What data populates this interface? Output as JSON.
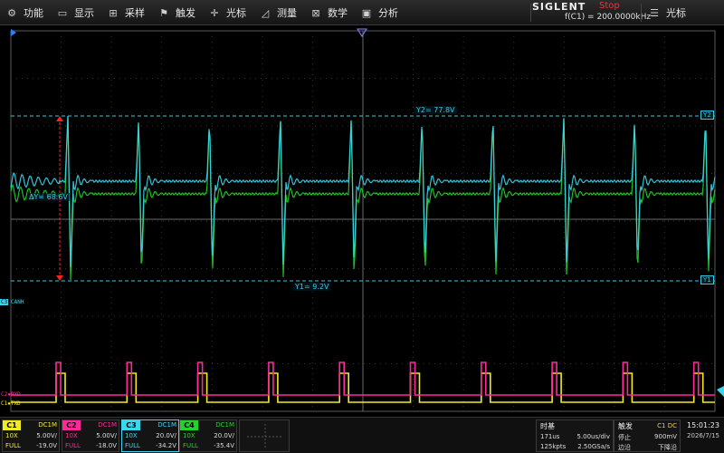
{
  "menu": {
    "items": [
      {
        "label": "功能",
        "icon": "gear-icon"
      },
      {
        "label": "显示",
        "icon": "display-icon"
      },
      {
        "label": "采样",
        "icon": "acquire-icon"
      },
      {
        "label": "触发",
        "icon": "trigger-flag-icon"
      },
      {
        "label": "光标",
        "icon": "cursor-icon"
      },
      {
        "label": "测量",
        "icon": "measure-icon"
      },
      {
        "label": "数学",
        "icon": "math-icon"
      },
      {
        "label": "分析",
        "icon": "analysis-icon"
      }
    ],
    "brand": "SIGLENT",
    "run_status": "Stop",
    "frequency": "f(C1) = 200.0000kHz",
    "cursor_menu": "光标"
  },
  "screen": {
    "cursor_y2_readout": "Y2= 77.8V",
    "cursor_y1_readout": "Y1= 9.2V",
    "delta_y_readout": "ΔY= 68.6V",
    "y2_tag": "Y2",
    "y1_tag": "Y1",
    "c3_tag": "C3",
    "c3_label": "CANH",
    "c2_label": "C2▪RXD",
    "c1_label": "C1▪TXD",
    "colors": {
      "c1": "#f2ea25",
      "c2": "#ff2a9a",
      "c3": "#3ad6ee",
      "c4": "#22d32a",
      "cursor": "#38c8e6"
    }
  },
  "channels": [
    {
      "name": "C1",
      "coupling": "DC1M",
      "probe": "10X",
      "scale": "5.00V/",
      "bw": "FULL",
      "offset": "-19.0V",
      "color": "#f2ea25"
    },
    {
      "name": "C2",
      "coupling": "DC1M",
      "probe": "10X",
      "scale": "5.00V/",
      "bw": "FULL",
      "offset": "-18.0V",
      "color": "#ff2a9a"
    },
    {
      "name": "C3",
      "coupling": "DC1M",
      "probe": "10X",
      "scale": "20.0V/",
      "bw": "FULL",
      "offset": "-34.2V",
      "color": "#3ad6ee"
    },
    {
      "name": "C4",
      "coupling": "DC1M",
      "probe": "10X",
      "scale": "20.0V/",
      "bw": "FULL",
      "offset": "-35.4V",
      "color": "#22d32a"
    }
  ],
  "timebase": {
    "title": "时基",
    "delay": "171us",
    "scale": "5.00us/div",
    "memory": "125kpts",
    "sample_rate": "2.50GSa/s"
  },
  "trigger": {
    "title": "触发",
    "source": "C1 DC",
    "state_label": "停止",
    "level": "900mV",
    "edge_label": "边沿",
    "slope": "下降沿"
  },
  "clock": {
    "time": "15:01:23",
    "date": "2026/7/15"
  }
}
